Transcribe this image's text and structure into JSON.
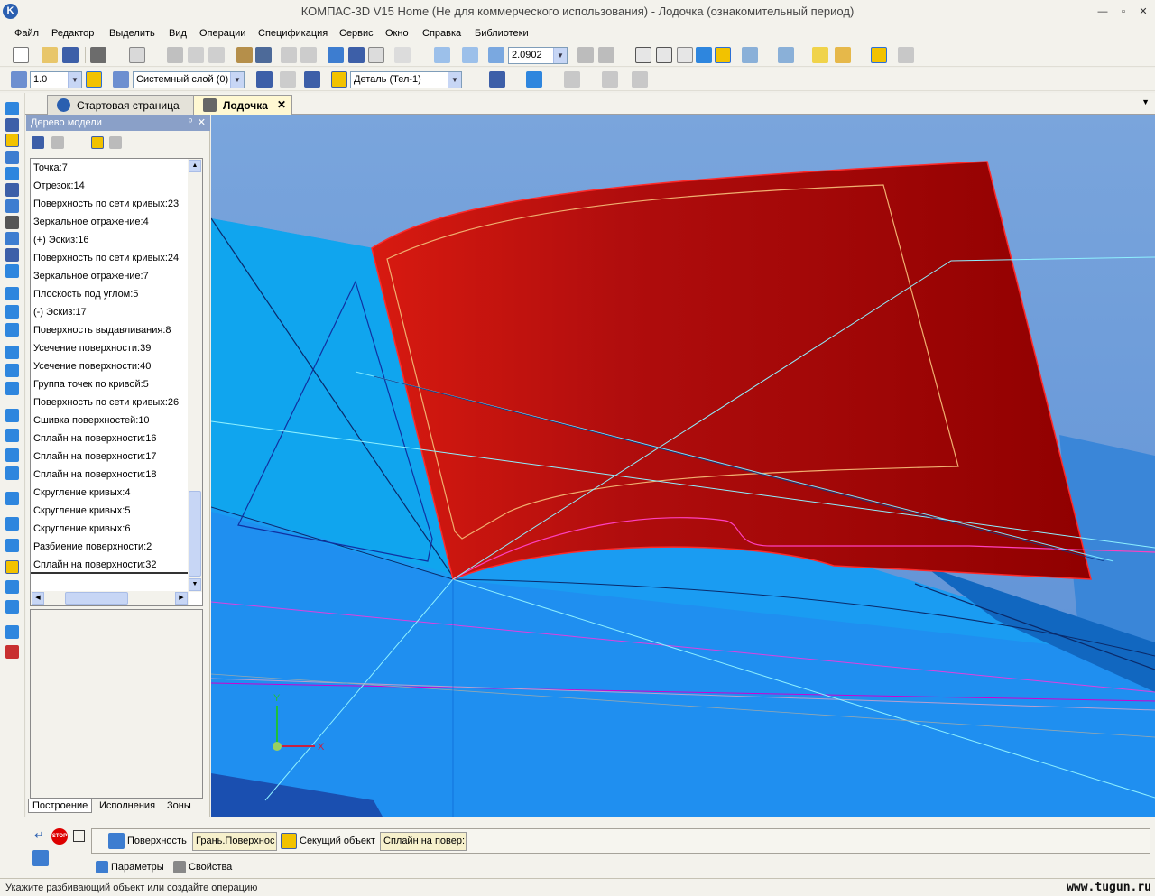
{
  "window": {
    "title": "КОМПАС-3D V15 Home (Не для коммерческого использования) - Лодочка (ознакомительный период)",
    "logo_letter": "K",
    "minimize": "—",
    "restore": "▫",
    "close": "✕"
  },
  "menu": [
    "Файл",
    "Редактор",
    "Выделить",
    "Вид",
    "Операции",
    "Спецификация",
    "Сервис",
    "Окно",
    "Справка",
    "Библиотеки"
  ],
  "toolbar1": {
    "zoom_value": "2.0902"
  },
  "toolbar2": {
    "step_value": "1.0",
    "layer_value": "Системный слой (0)",
    "part_value": "Деталь (Тел-1)"
  },
  "tabs": [
    {
      "label": "Стартовая страница"
    },
    {
      "label": "Лодочка",
      "close": "✕"
    }
  ],
  "tab_overflow": "▼",
  "model_tree": {
    "title": "Дерево модели",
    "pin": "ᵖ",
    "close": "✕",
    "items": [
      "Точка:7",
      "Отрезок:14",
      "Поверхность по сети кривых:23",
      "Зеркальное отражение:4",
      "(+) Эскиз:16",
      "Поверхность по сети кривых:24",
      "Зеркальное отражение:7",
      "Плоскость под углом:5",
      "(-) Эскиз:17",
      "Поверхность выдавливания:8",
      "Усечение поверхности:39",
      "Усечение поверхности:40",
      "Группа точек по кривой:5",
      "Поверхность по сети кривых:26",
      "Сшивка поверхностей:10",
      "Сплайн на поверхности:16",
      "Сплайн на поверхности:17",
      "Сплайн на поверхности:18",
      "Скругление кривых:4",
      "Скругление кривых:5",
      "Скругление кривых:6",
      "Разбиение поверхности:2",
      "Сплайн на поверхности:32"
    ],
    "bottom_tabs": [
      "Построение",
      "Исполнения",
      "Зоны"
    ]
  },
  "viewport": {
    "axis_x": "X",
    "axis_y": "Y"
  },
  "operation_panel": {
    "surface_label": "Поверхность",
    "surface_value": "Грань.Поверхнос",
    "cutter_label": "Секущий объект",
    "cutter_value": "Сплайн на повер:",
    "stop_label": "STOP",
    "tab_params": "Параметры",
    "tab_props": "Свойства"
  },
  "status": {
    "text": "Укажите разбивающий объект или создайте операцию",
    "watermark": "www.tugun.ru"
  },
  "colors": {
    "viewport_bg": "#3aa0f0",
    "surface_red": "#b00d0d",
    "panel_head": "#8aa0c8"
  }
}
